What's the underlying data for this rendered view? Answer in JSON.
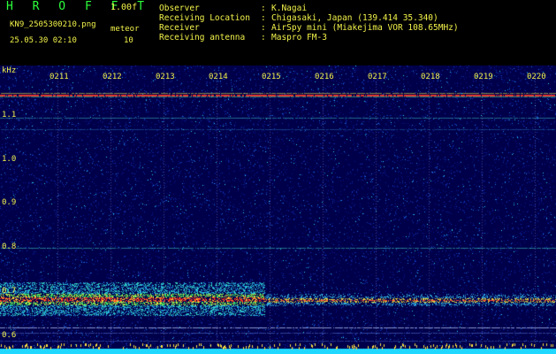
{
  "header": {
    "brand": "H R O F F T",
    "version": "1.00f",
    "filename": "KN9_2505300210.png",
    "unit": "meteor",
    "timestamp": "25.05.30 02:10",
    "count": "10"
  },
  "info": [
    {
      "label": "Observer",
      "value": "K.Nagai"
    },
    {
      "label": "Receiving Location",
      "value": "Chigasaki, Japan (139.414 35.340)"
    },
    {
      "label": "Receiver",
      "value": "AirSpy mini (Miakejima VOR 108.65MHz)"
    },
    {
      "label": "Receiving antenna",
      "value": "Maspro FM-3"
    }
  ],
  "separator": ":",
  "axis": {
    "y_unit": "kHz",
    "y_ticks": [
      "1.1",
      "1.0",
      "0.9",
      "0.8",
      "0.7",
      "0.6"
    ],
    "x_ticks": [
      "0211",
      "0212",
      "0213",
      "0214",
      "0215",
      "0216",
      "0217",
      "0218",
      "0219",
      "0220"
    ]
  },
  "colors": {
    "header_text": "#f2f24a",
    "brand": "#2cff3c",
    "noise_bg": "#00005a",
    "signal": "#ff2a2a"
  }
}
